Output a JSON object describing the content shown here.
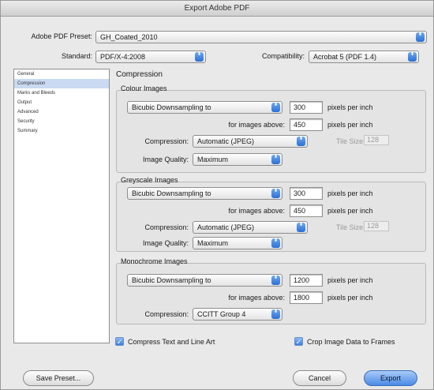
{
  "window": {
    "title": "Export Adobe PDF"
  },
  "preset": {
    "label": "Adobe PDF Preset:",
    "value": "GH_Coated_2010"
  },
  "standard": {
    "label": "Standard:",
    "value": "PDF/X-4:2008"
  },
  "compatibility": {
    "label": "Compatibility:",
    "value": "Acrobat 5 (PDF 1.4)"
  },
  "sidebar": {
    "items": [
      {
        "label": "General"
      },
      {
        "label": "Compression"
      },
      {
        "label": "Marks and Bleeds"
      },
      {
        "label": "Output"
      },
      {
        "label": "Advanced"
      },
      {
        "label": "Security"
      },
      {
        "label": "Summary"
      }
    ],
    "selected": "Compression"
  },
  "section_title": "Compression",
  "colour": {
    "title": "Colour Images",
    "method": "Bicubic Downsampling to",
    "ppi": "300",
    "ppi_unit": "pixels per inch",
    "above_label": "for images above:",
    "above": "450",
    "above_unit": "pixels per inch",
    "compression_label": "Compression:",
    "compression": "Automatic (JPEG)",
    "tile_label": "Tile Size:",
    "tile": "128",
    "quality_label": "Image Quality:",
    "quality": "Maximum"
  },
  "greyscale": {
    "title": "Greyscale Images",
    "method": "Bicubic Downsampling to",
    "ppi": "300",
    "ppi_unit": "pixels per inch",
    "above_label": "for images above:",
    "above": "450",
    "above_unit": "pixels per inch",
    "compression_label": "Compression:",
    "compression": "Automatic (JPEG)",
    "tile_label": "Tile Size:",
    "tile": "128",
    "quality_label": "Image Quality:",
    "quality": "Maximum"
  },
  "monochrome": {
    "title": "Monochrome Images",
    "method": "Bicubic Downsampling to",
    "ppi": "1200",
    "ppi_unit": "pixels per inch",
    "above_label": "for images above:",
    "above": "1800",
    "above_unit": "pixels per inch",
    "compression_label": "Compression:",
    "compression": "CCITT Group 4"
  },
  "options": {
    "compress_text": "Compress Text and Line Art",
    "crop_image": "Crop Image Data to Frames"
  },
  "buttons": {
    "save_preset": "Save Preset...",
    "cancel": "Cancel",
    "export": "Export"
  },
  "icons": {
    "popup_arrows": "⬍",
    "check": "✓"
  }
}
